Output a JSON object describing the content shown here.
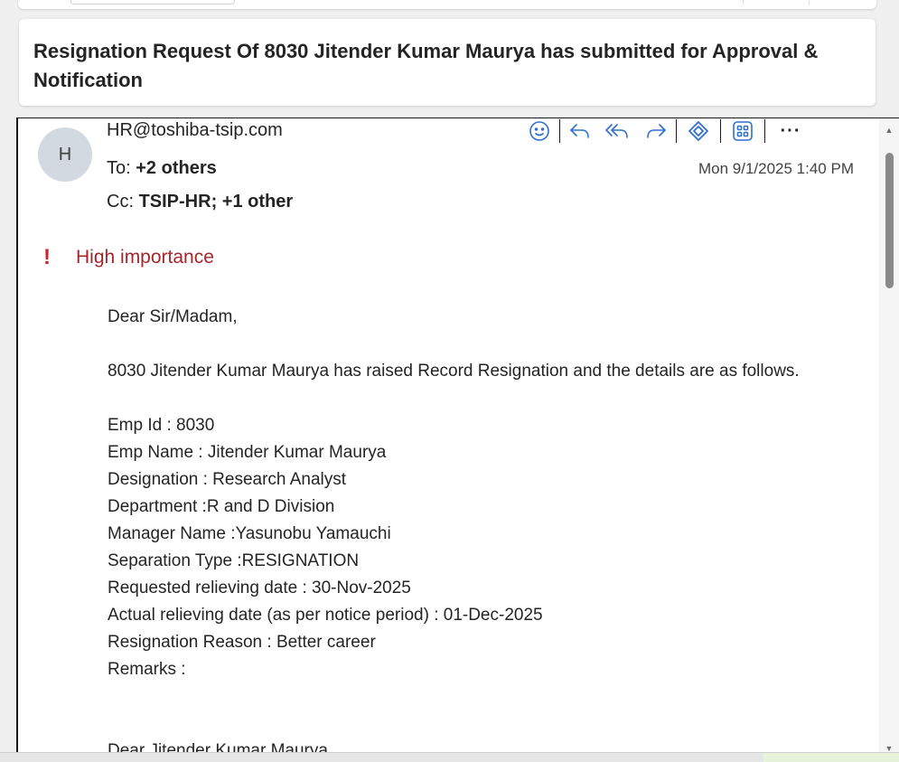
{
  "subject": "Resignation Request Of 8030 Jitender Kumar Maurya has submitted for Approval & Notification",
  "message": {
    "avatar_initial": "H",
    "sender": "HR@toshiba-tsip.com",
    "to_label": "To:",
    "to_value": "+2 others",
    "cc_label": "Cc:",
    "cc_value": "TSIP-HR;  +1 other",
    "date": "Mon 9/1/2025 1:40 PM",
    "importance": "High importance"
  },
  "actions": {
    "emoji": "emoji-icon",
    "reply": "reply-icon",
    "reply_all": "reply-all-icon",
    "forward": "forward-icon",
    "loop": "loop-app-icon",
    "apps": "apps-grid-icon",
    "more": "···"
  },
  "body": {
    "greeting": "Dear Sir/Madam,",
    "intro": "8030 Jitender Kumar Maurya has raised Record Resignation and the details are as follows.",
    "details": [
      "Emp Id  : 8030",
      "Emp Name  : Jitender Kumar Maurya",
      "Designation  : Research Analyst",
      "Department  :R and D Division",
      "Manager Name  :Yasunobu Yamauchi",
      "Separation Type  :RESIGNATION",
      "Requested relieving date  : 30-Nov-2025",
      "Actual relieving date (as per notice period)  : 01-Dec-2025",
      "Resignation Reason  : Better career",
      "Remarks  :"
    ],
    "closing_greeting": "Dear Jitender Kumar Maurya,"
  },
  "colors": {
    "accent": "#2f6fd0",
    "importance": "#a4262c"
  }
}
